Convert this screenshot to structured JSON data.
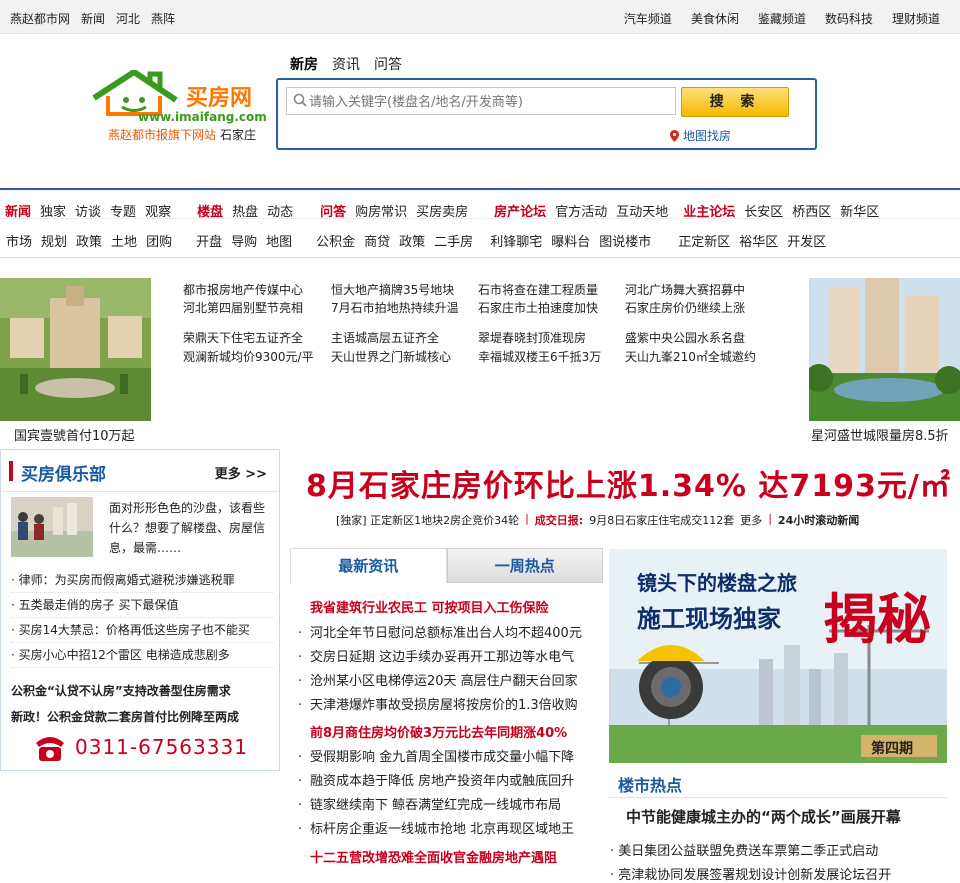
{
  "topbar": {
    "left": [
      "燕赵都市网",
      "新闻",
      "河北",
      "燕阵"
    ],
    "right": [
      "汽车频道",
      "美食休闲",
      "鉴藏频道",
      "数码科技",
      "理财频道"
    ]
  },
  "logo": {
    "brand": "买房网",
    "url": "www.imaifang.com",
    "slogan": "燕赵都市报旗下网站",
    "city": "石家庄"
  },
  "search": {
    "tabs": [
      "新房",
      "资讯",
      "问答"
    ],
    "placeholder": "请输入关键字(楼盘名/地名/开发商等)",
    "button": "搜 索",
    "map_link": "地图找房"
  },
  "nav": {
    "row1": [
      {
        "red": "新闻",
        "items": [
          "独家",
          "访谈",
          "专题",
          "观察"
        ]
      },
      {
        "red": "楼盘",
        "items": [
          "热盘",
          "动态"
        ]
      },
      {
        "red": "问答",
        "items": [
          "购房常识",
          "买房卖房"
        ]
      },
      {
        "red": "房产论坛",
        "items": [
          "官方活动",
          "互动天地"
        ]
      },
      {
        "red": "业主论坛",
        "items": [
          "长安区",
          "桥西区",
          "新华区"
        ]
      }
    ],
    "row2": [
      {
        "items": [
          "市场",
          "规划",
          "政策",
          "土地",
          "团购"
        ]
      },
      {
        "items": [
          "开盘",
          "导购",
          "地图"
        ]
      },
      {
        "items": [
          "公积金",
          "商贷",
          "政策",
          "二手房"
        ]
      },
      {
        "items": [
          "利锋聊宅",
          "曝料台",
          "图说楼市"
        ]
      },
      {
        "items": [
          "正定新区",
          "裕华区",
          "开发区"
        ]
      }
    ]
  },
  "banner": {
    "caption_left": "国宾壹號首付10万起",
    "caption_right": "星河盛世城限量房8.5折",
    "headlines": [
      [
        "都市报房地产传媒中心",
        "河北第四届别墅节亮相"
      ],
      [
        "恒大地产摘牌35号地块",
        "7月石市拍地热持续升温"
      ],
      [
        "石市将查在建工程质量",
        "石家庄市土拍速度加快"
      ],
      [
        "河北广场舞大赛招募中",
        "石家庄房价仍继续上涨"
      ],
      [
        "荣鼎天下住宅五证齐全",
        "观澜新城均价9300元/平"
      ],
      [
        "主语城高层五证齐全",
        "天山世界之门新城核心"
      ],
      [
        "翠堤春晓封顶准现房",
        "幸福城双楼王6千抵3万"
      ],
      [
        "盛紫中央公园水系名盘",
        "天山九峯210㎡全城邀约"
      ]
    ]
  },
  "club": {
    "title": "买房俱乐部",
    "more": "更多 >>",
    "intro": "面对形形色色的沙盘，该看些什么？想要了解楼盘、房屋信息，最需……",
    "list": [
      "律师：为买房而假离婚式避税涉嫌逃税罪",
      "五类最走俏的房子 买下最保值",
      "买房14大禁忌：价格再低这些房子也不能买",
      "买房小心中招12个雷区 电梯造成悲剧多"
    ],
    "bold1": "公积金“认贷不认房”支持改善型住房需求",
    "bold2": "新政！公积金贷款二套房首付比例降至两成",
    "phone": "0311-67563331"
  },
  "main": {
    "headline": "8月石家庄房价环比上涨1.34% 达7193元/㎡",
    "sub_exclusive": "[独家] 正定新区1地块2房企竞价34轮",
    "sub_red": "成交日报:",
    "sub_deal": "9月8日石家庄住宅成交112套",
    "sub_more": "更多",
    "sub_bold": "24小时滚动新闻"
  },
  "tabs": [
    "最新资讯",
    "一周热点"
  ],
  "news": [
    {
      "red": true,
      "text": "我省建筑行业农民工 可按项目入工伤保险"
    },
    {
      "red": false,
      "text": "河北全年节日慰问总额标准出台人均不超400元"
    },
    {
      "red": false,
      "text": "交房日延期 这边手续办妥再开工那边等水电气"
    },
    {
      "red": false,
      "text": "沧州某小区电梯停运20天 高层住户翻天台回家"
    },
    {
      "red": false,
      "text": "天津港爆炸事故受损房屋将按房价的1.3倍收购"
    },
    {
      "red": true,
      "text": "前8月商住房均价破3万元比去年同期涨40%"
    },
    {
      "red": false,
      "text": "受假期影响 金九首周全国楼市成交量小幅下降"
    },
    {
      "red": false,
      "text": "融资成本趋于降低 房地产投资年内或触底回升"
    },
    {
      "red": false,
      "text": "链家继续南下 鲸吞满堂红完成一线城市布局"
    },
    {
      "red": false,
      "text": "标杆房企重返一线城市抢地 北京再现区域地王"
    },
    {
      "red": true,
      "text": "十二五营改增恐难全面收官金融房地产遇阻"
    }
  ],
  "promo": {
    "line1": "镜头下的楼盘之旅",
    "line2": "施工现场独家",
    "big": "揭秘",
    "issue": "第四期"
  },
  "hot": {
    "label": "楼市热点",
    "title": "中节能健康城主办的“两个成长”画展开幕",
    "items": [
      "美日集团公益联盟免费送车票第二季正式启动",
      "亮津栽协同发展签署规划设计创新发展论坛召开"
    ]
  },
  "colors": {
    "accent_blue": "#2a5fa8",
    "red": "#c8001e",
    "orange": "#ff7700",
    "green": "#3a9a1d"
  }
}
